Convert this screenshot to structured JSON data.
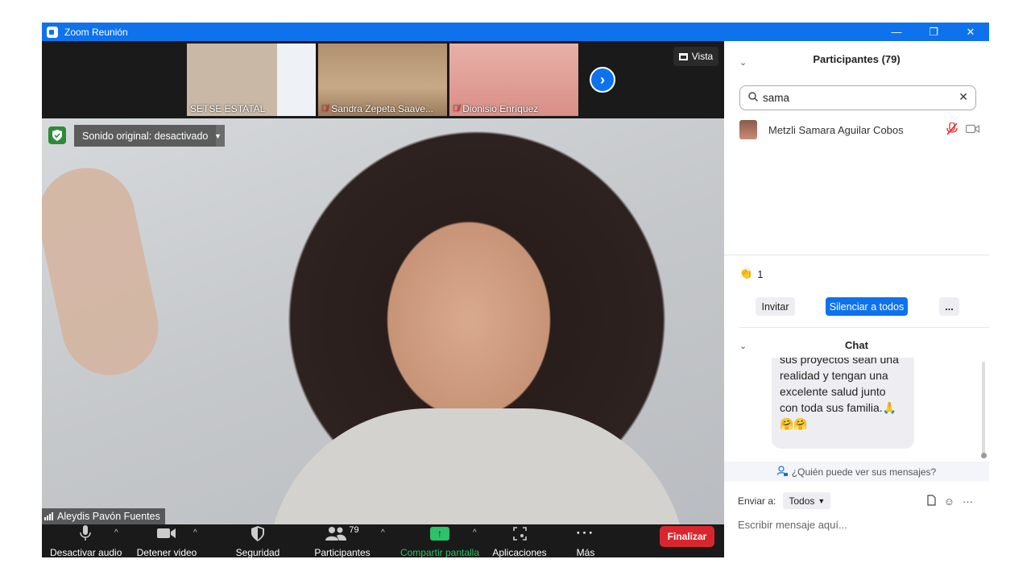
{
  "window": {
    "title": "Zoom Reunión",
    "controls": {
      "minimize": "—",
      "restore": "❐",
      "close": "✕"
    }
  },
  "thumbnails": [
    {
      "name": "SETSE ESTATAL",
      "muted": false
    },
    {
      "name": "Sandra Zepeta Saave...",
      "muted": true
    },
    {
      "name": "Dionisio Enríquez",
      "muted": true
    }
  ],
  "view_button": {
    "label": "Vista"
  },
  "main_video": {
    "original_sound": "Sonido original: desactivado",
    "speaker_name": "Aleydis Pavón Fuentes"
  },
  "toolbar": {
    "mute": "Desactivar audio",
    "video": "Detener video",
    "security": "Seguridad",
    "participants": "Participantes",
    "participants_count": "79",
    "share": "Compartir pantalla",
    "apps": "Aplicaciones",
    "more": "Más",
    "end": "Finalizar"
  },
  "participants_panel": {
    "title": "Participantes (79)",
    "search_value": "sama",
    "results": [
      {
        "name": "Metzli Samara Aguilar Cobos"
      }
    ],
    "reaction_count": "1",
    "invite": "Invitar",
    "mute_all": "Silenciar a todos",
    "more": "..."
  },
  "chat_panel": {
    "title": "Chat",
    "message_lines": [
      "sus proyectos sean una",
      "realidad y tengan una",
      "excelente salud junto",
      "con toda sus familia.🙏",
      "🤗🤗"
    ],
    "who_can_see": "¿Quién puede ver sus mensajes?",
    "send_to_label": "Enviar a:",
    "send_to_value": "Todos",
    "input_placeholder": "Escribir mensaje aquí..."
  },
  "colors": {
    "zoom_blue": "#0e72ed",
    "end_red": "#d9262e",
    "share_green": "#2cc16a"
  }
}
